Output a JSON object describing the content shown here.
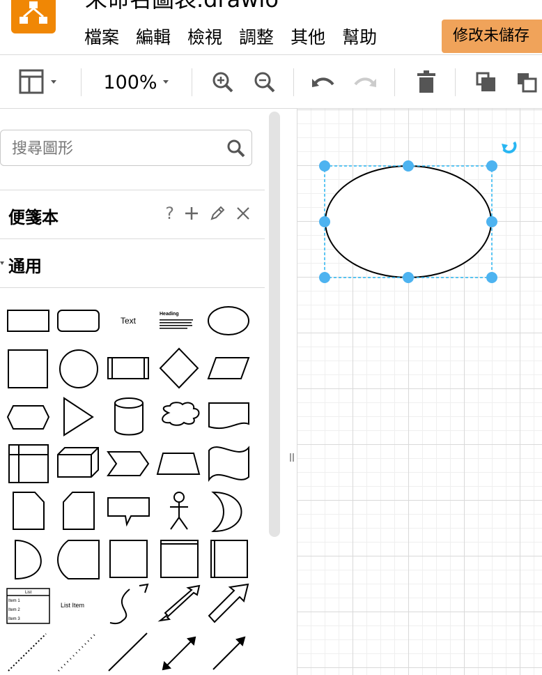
{
  "app": {
    "title": "未命名圖表.drawio",
    "unsaved_label": "修改未儲存"
  },
  "menu": [
    "檔案",
    "編輯",
    "檢視",
    "調整",
    "其他",
    "幫助"
  ],
  "toolbar": {
    "zoom": "100%"
  },
  "sidebar": {
    "search_placeholder": "搜尋圖形",
    "scratchpad": {
      "title": "便箋本",
      "help": "?"
    },
    "general": {
      "title": "通用"
    },
    "shapes": {
      "text_label": "Text",
      "heading_label": "Heading",
      "heading_body": "Lorem ipsum dolor sit amet, consectetur adipisicing elit, sed do eiusmod tempor incididunt ut labore et dolore magna aliqua.",
      "list_title": "List",
      "list_items": [
        "Item 1",
        "Item 2",
        "Item 3"
      ],
      "list_item_label": "List Item"
    }
  },
  "colors": {
    "accent": "#f08705",
    "unsaved_bg": "#f0a35a",
    "selection": "#29b6f2",
    "handle": "#4db3f0",
    "icon": "#555555"
  }
}
